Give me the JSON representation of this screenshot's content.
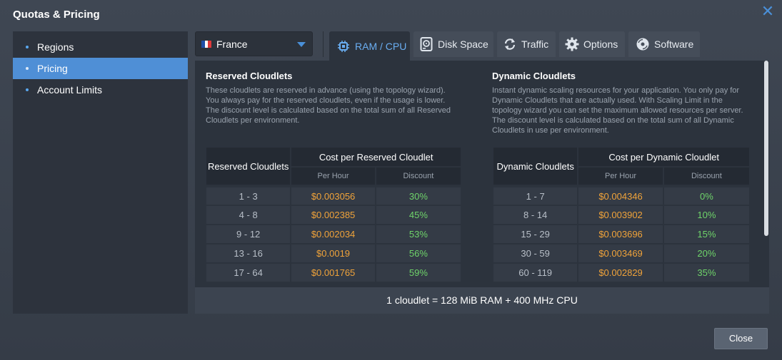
{
  "window": {
    "title": "Quotas & Pricing"
  },
  "sidebar": {
    "items": [
      {
        "label": "Regions",
        "active": false
      },
      {
        "label": "Pricing",
        "active": true
      },
      {
        "label": "Account Limits",
        "active": false
      }
    ]
  },
  "region": {
    "selected": "France",
    "flag_colors": [
      "#1f4fa8",
      "#ffffff",
      "#e03a3a"
    ]
  },
  "tabs": [
    {
      "label": "RAM / CPU",
      "icon": "cpu-icon",
      "active": true
    },
    {
      "label": "Disk Space",
      "icon": "disk-icon",
      "active": false
    },
    {
      "label": "Traffic",
      "icon": "traffic-icon",
      "active": false
    },
    {
      "label": "Options",
      "icon": "gear-icon",
      "active": false
    },
    {
      "label": "Software",
      "icon": "software-icon",
      "active": false
    }
  ],
  "reserved": {
    "heading": "Reserved Cloudlets",
    "description": "These cloudlets are reserved in advance (using the topology wizard). You always pay for the reserved cloudlets, even if the usage is lower. The discount level is calculated based on the total sum of all Reserved Cloudlets per environment.",
    "table": {
      "col1": "Reserved Cloudlets",
      "group": "Cost per Reserved Cloudlet",
      "per_hour": "Per Hour",
      "discount": "Discount",
      "rows": [
        {
          "range": "1 - 3",
          "price": "$0.003056",
          "discount": "30%"
        },
        {
          "range": "4 - 8",
          "price": "$0.002385",
          "discount": "45%"
        },
        {
          "range": "9 - 12",
          "price": "$0.002034",
          "discount": "53%"
        },
        {
          "range": "13 - 16",
          "price": "$0.0019",
          "discount": "56%"
        },
        {
          "range": "17 - 64",
          "price": "$0.001765",
          "discount": "59%"
        }
      ]
    }
  },
  "dynamic": {
    "heading": "Dynamic Cloudlets",
    "description": "Instant dynamic scaling resources for your application. You only pay for Dynamic Cloudlets that are actually used. With Scaling Limit in the topology wizard you can set the maximum allowed resources per server. The discount level is calculated based on the total sum of all Dynamic Cloudlets in use per environment.",
    "table": {
      "col1": "Dynamic Cloudlets",
      "group": "Cost per Dynamic Cloudlet",
      "per_hour": "Per Hour",
      "discount": "Discount",
      "rows": [
        {
          "range": "1 - 7",
          "price": "$0.004346",
          "discount": "0%"
        },
        {
          "range": "8 - 14",
          "price": "$0.003902",
          "discount": "10%"
        },
        {
          "range": "15 - 29",
          "price": "$0.003696",
          "discount": "15%"
        },
        {
          "range": "30 - 59",
          "price": "$0.003469",
          "discount": "20%"
        },
        {
          "range": "60 - 119",
          "price": "$0.002829",
          "discount": "35%"
        }
      ]
    }
  },
  "footer": {
    "note": "1 cloudlet = 128 MiB RAM + 400 MHz CPU"
  },
  "buttons": {
    "close": "Close"
  },
  "colors": {
    "accent": "#4a90d9",
    "price": "#f0a33a",
    "discount": "#6fd46a"
  }
}
